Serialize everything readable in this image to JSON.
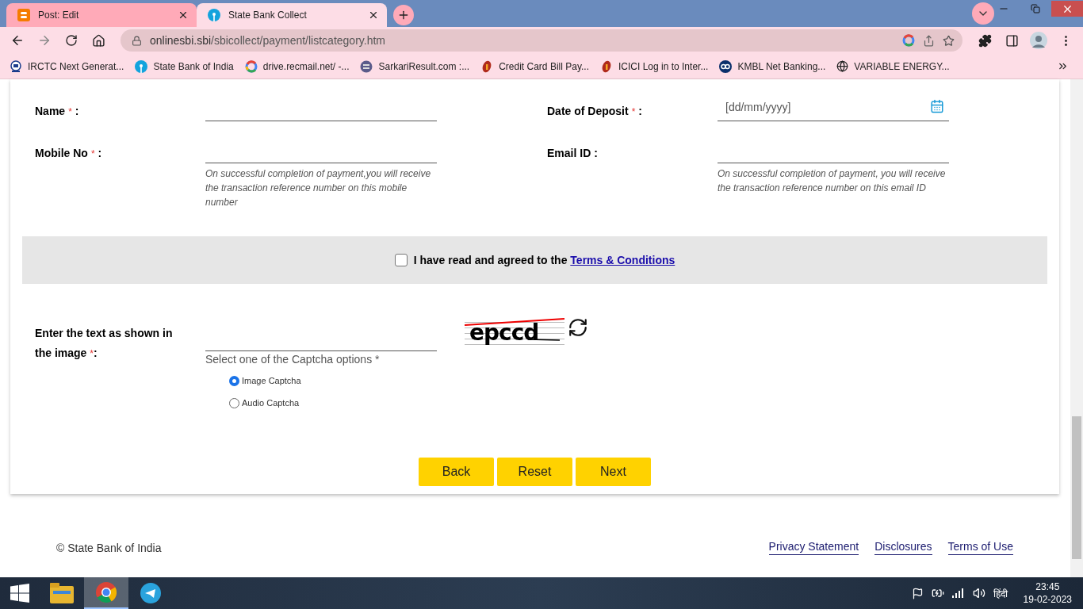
{
  "browser": {
    "tabs": [
      {
        "title": "Post: Edit",
        "selected": false,
        "kind": "blogger"
      },
      {
        "title": "State Bank Collect",
        "selected": true,
        "kind": "sbi"
      }
    ],
    "url": {
      "domain": "onlinesbi.sbi",
      "path": "/sbicollect/payment/listcategory.htm"
    },
    "bookmarks": [
      {
        "label": "IRCTC Next Generat...",
        "kind": "irctc"
      },
      {
        "label": "State Bank of India",
        "kind": "sbi"
      },
      {
        "label": "drive.recmail.net/ -...",
        "kind": "google"
      },
      {
        "label": "SarkariResult.com :...",
        "kind": "sarkari"
      },
      {
        "label": "Credit Card Bill Pay...",
        "kind": "icici"
      },
      {
        "label": "ICICI Log in to Inter...",
        "kind": "icici"
      },
      {
        "label": "KMBL Net Banking...",
        "kind": "kmbl"
      },
      {
        "label": "VARIABLE ENERGY...",
        "kind": "globe"
      }
    ]
  },
  "form": {
    "rows": [
      {
        "left": {
          "label": "Name",
          "mark": "*",
          "colon": ":"
        },
        "right": {
          "label": "Date of Deposit",
          "mark": "*",
          "colon": ":",
          "placeholder": "[dd/mm/yyyy]",
          "kind": "date"
        }
      },
      {
        "left": {
          "label": "Mobile No",
          "mark": "*",
          "colon": ":",
          "hint": "On successful completion of payment,you will receive the transaction reference number on this mobile number"
        },
        "right": {
          "label": "Email ID",
          "colon": ":",
          "hint": "On successful completion of payment, you will receive the transaction reference number on this email ID"
        }
      }
    ],
    "agreement": {
      "checked": false,
      "text": "I have read and agreed to the",
      "link": "Terms & Conditions"
    },
    "captcha": {
      "label_lines": [
        "Enter the text as shown in",
        "the image"
      ],
      "mark": "*",
      "colon": ":",
      "prompt": "Select one of the Captcha options *",
      "image_text": "epccd",
      "options": [
        {
          "label": "Image Captcha",
          "selected": true
        },
        {
          "label": "Audio Captcha",
          "selected": false
        }
      ]
    },
    "buttons": [
      "Back",
      "Reset",
      "Next"
    ]
  },
  "footer": {
    "copyright": "© State Bank of India",
    "links": [
      "Privacy Statement",
      "Disclosures",
      "Terms of Use"
    ]
  },
  "taskbar": {
    "apps": [
      {
        "kind": "explorer",
        "selected": false
      },
      {
        "kind": "chrome",
        "selected": true
      },
      {
        "kind": "telegram",
        "selected": false
      }
    ],
    "language": "हिंदी",
    "time": "23:45",
    "date": "19-02-2023"
  }
}
